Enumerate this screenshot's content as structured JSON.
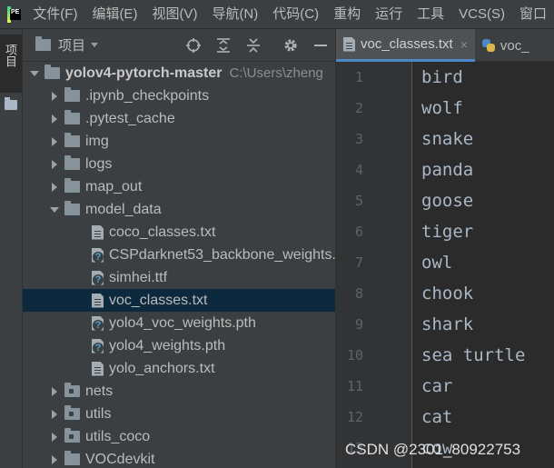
{
  "menubar": {
    "logo_text": "PE",
    "items": [
      "文件(F)",
      "编辑(E)",
      "视图(V)",
      "导航(N)",
      "代码(C)",
      "重构",
      "运行",
      "工具",
      "VCS(S)",
      "窗口"
    ]
  },
  "toolstrip": {
    "project_label": "项目"
  },
  "project_panel": {
    "title": "项目",
    "tree": [
      {
        "label": "yolov4-pytorch-master",
        "path": "C:\\Users\\zheng",
        "type": "folder",
        "expanded": true,
        "indent": 0
      },
      {
        "label": ".ipynb_checkpoints",
        "type": "folder",
        "expanded": false,
        "indent": 1
      },
      {
        "label": ".pytest_cache",
        "type": "folder",
        "expanded": false,
        "indent": 1
      },
      {
        "label": "img",
        "type": "folder",
        "expanded": false,
        "indent": 1
      },
      {
        "label": "logs",
        "type": "folder",
        "expanded": false,
        "indent": 1
      },
      {
        "label": "map_out",
        "type": "folder",
        "expanded": false,
        "indent": 1
      },
      {
        "label": "model_data",
        "type": "folder",
        "expanded": true,
        "indent": 1
      },
      {
        "label": "coco_classes.txt",
        "type": "file",
        "indent": 2
      },
      {
        "label": "CSPdarknet53_backbone_weights.",
        "type": "file-unknown",
        "indent": 2
      },
      {
        "label": "simhei.ttf",
        "type": "file-unknown",
        "indent": 2
      },
      {
        "label": "voc_classes.txt",
        "type": "file",
        "indent": 2,
        "selected": true
      },
      {
        "label": "yolo4_voc_weights.pth",
        "type": "file-unknown",
        "indent": 2
      },
      {
        "label": "yolo4_weights.pth",
        "type": "file-unknown",
        "indent": 2
      },
      {
        "label": "yolo_anchors.txt",
        "type": "file",
        "indent": 2
      },
      {
        "label": "nets",
        "type": "package",
        "expanded": false,
        "indent": 1
      },
      {
        "label": "utils",
        "type": "package",
        "expanded": false,
        "indent": 1
      },
      {
        "label": "utils_coco",
        "type": "package",
        "expanded": false,
        "indent": 1
      },
      {
        "label": "VOCdevkit",
        "type": "folder",
        "expanded": false,
        "indent": 1
      }
    ]
  },
  "editor": {
    "tabs": [
      {
        "label": "voc_classes.txt",
        "active": true,
        "close": "×"
      },
      {
        "label": "voc_",
        "active": false
      }
    ],
    "lines": [
      {
        "num": "1",
        "text": "bird"
      },
      {
        "num": "2",
        "text": "wolf"
      },
      {
        "num": "3",
        "text": "snake"
      },
      {
        "num": "4",
        "text": "panda"
      },
      {
        "num": "5",
        "text": "goose"
      },
      {
        "num": "6",
        "text": "tiger"
      },
      {
        "num": "7",
        "text": "owl"
      },
      {
        "num": "8",
        "text": "chook"
      },
      {
        "num": "9",
        "text": "shark"
      },
      {
        "num": "10",
        "text": "sea turtle"
      },
      {
        "num": "11",
        "text": "car"
      },
      {
        "num": "12",
        "text": "cat"
      },
      {
        "num": "13",
        "text": "cow"
      }
    ]
  },
  "watermark": "CSDN @2301_80922753"
}
